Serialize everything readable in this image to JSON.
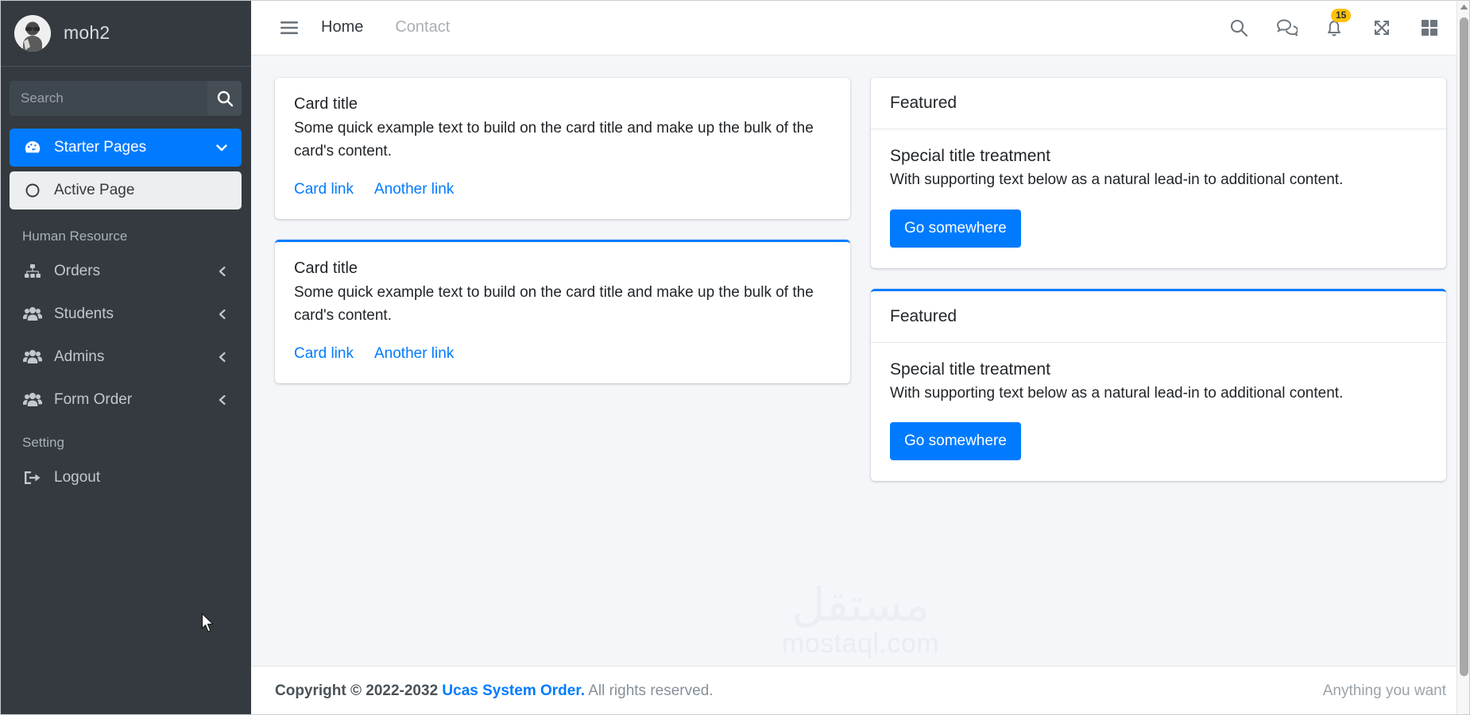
{
  "sidebar": {
    "brand_name": "moh2",
    "avatar_icon": "user-avatar-photo",
    "search": {
      "placeholder": "Search",
      "value": "",
      "icon": "search-icon"
    },
    "nav": [
      {
        "label": "Starter Pages",
        "icon": "dashboard-gauge-icon",
        "state": "active",
        "caret": "chevron-down-icon"
      }
    ],
    "sub_items": [
      {
        "label": "Active Page",
        "icon": "circle-outline-icon"
      }
    ],
    "sections": [
      {
        "header": "Human Resource",
        "items": [
          {
            "label": "Orders",
            "icon": "sitemap-icon",
            "caret": "chevron-left-icon"
          },
          {
            "label": "Students",
            "icon": "users-icon",
            "caret": "chevron-left-icon"
          },
          {
            "label": "Admins",
            "icon": "users-icon",
            "caret": "chevron-left-icon"
          },
          {
            "label": "Form Order",
            "icon": "users-icon",
            "caret": "chevron-left-icon"
          }
        ]
      },
      {
        "header": "Setting",
        "items": [
          {
            "label": "Logout",
            "icon": "logout-icon",
            "caret": ""
          }
        ]
      }
    ]
  },
  "topbar": {
    "menu_toggle_icon": "hamburger-icon",
    "links": [
      {
        "label": "Home",
        "state": "active"
      },
      {
        "label": "Contact",
        "state": "muted"
      }
    ],
    "icons": [
      {
        "name": "search-icon",
        "badge": ""
      },
      {
        "name": "messages-icon",
        "badge": ""
      },
      {
        "name": "bell-icon",
        "badge": "15"
      },
      {
        "name": "fullscreen-icon",
        "badge": ""
      },
      {
        "name": "grid-apps-icon",
        "badge": ""
      }
    ],
    "notification_count": "15"
  },
  "content": {
    "left_cards": [
      {
        "title": "Card title",
        "text": "Some quick example text to build on the card title and make up the bulk of the card's content.",
        "link1": "Card link",
        "link2": "Another link",
        "accent": false
      },
      {
        "title": "Card title",
        "text": "Some quick example text to build on the card title and make up the bulk of the card's content.",
        "link1": "Card link",
        "link2": "Another link",
        "accent": true
      }
    ],
    "right_cards": [
      {
        "header": "Featured",
        "title": "Special title treatment",
        "text": "With supporting text below as a natural lead-in to additional content.",
        "button": "Go somewhere",
        "accent": false
      },
      {
        "header": "Featured",
        "title": "Special title treatment",
        "text": "With supporting text below as a natural lead-in to additional content.",
        "button": "Go somewhere",
        "accent": true
      }
    ]
  },
  "footer": {
    "copyright_prefix": "Copyright © 2022-2032",
    "brand": "Ucas System Order.",
    "rights": "All rights reserved.",
    "right_text": "Anything you want"
  },
  "watermark": {
    "arabic": "مستقل",
    "latin": "mostaql.com"
  },
  "colors": {
    "accent_blue": "#007bff",
    "sidebar_bg": "#343a40",
    "badge_yellow": "#ffc107",
    "content_bg": "#f4f6f9"
  }
}
